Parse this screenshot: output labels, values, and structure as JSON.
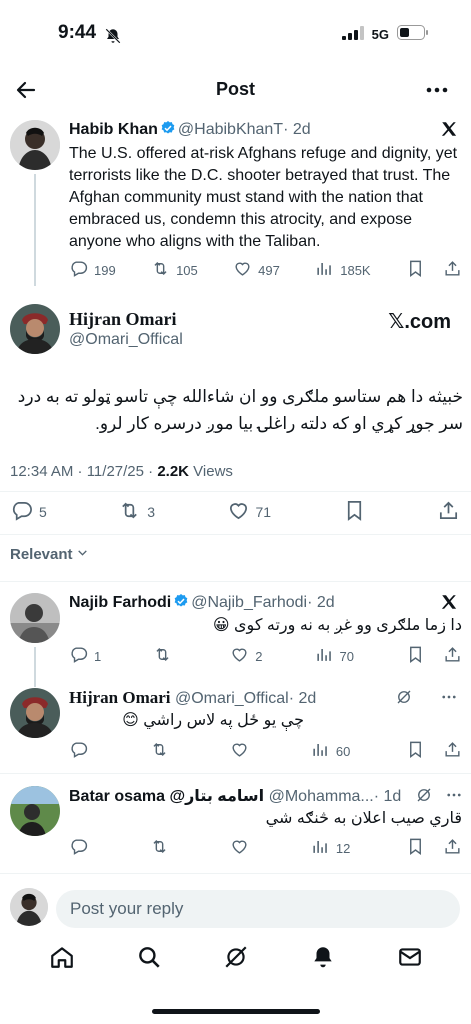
{
  "status": {
    "time": "9:44",
    "network": "5G"
  },
  "header": {
    "title": "Post"
  },
  "parent_tweet": {
    "name": "Habib Khan",
    "handle": "@HabibKhanT",
    "age": "· 2d",
    "text": "The U.S. offered at-risk Afghans refuge and dignity, yet terrorists like the D.C. shooter betrayed that trust. The Afghan community must stand with the nation that embraced us, condemn this atrocity, and expose anyone who aligns with the Taliban.",
    "replies": "199",
    "retweets": "105",
    "likes": "497",
    "views": "185K"
  },
  "main_tweet": {
    "name": "Hijran Omari",
    "handle": "@Omari_Offical",
    "watermark": "𝕏.com",
    "text": "خبيثه دا هم ستاسو ملګری وو ان شاءالله چې تاسو ټولو ته به درد سر جوړ کړي او که دلته راغلۍ بیا موږ درسره کار لرو.",
    "timestamp": "12:34 AM · 11/27/25 · ",
    "views_count": "2.2K",
    "views_label": " Views",
    "replies": "5",
    "retweets": "3",
    "likes": "71"
  },
  "sort": {
    "label": "Relevant"
  },
  "replies": [
    {
      "name": "Najib Farhodi",
      "handle": "@Najib_Farhodi",
      "age": "· 2d",
      "text": "دا زما ملګری وو غږ به نه ورته کوی 😀",
      "replies": "1",
      "retweets": "",
      "likes": "2",
      "views": "70"
    },
    {
      "name": "Hijran Omari",
      "handle": "@Omari_Offical",
      "age": "· 2d",
      "text": "چې یو ځل په لاس راشي 😊",
      "replies": "",
      "retweets": "",
      "likes": "",
      "views": "60"
    },
    {
      "name": "Batar osama @اسامه بتار",
      "handle": "@Mohamma...",
      "age": "· 1d",
      "text": "قاري صيب اعلان به څنګه شي",
      "replies": "",
      "retweets": "",
      "likes": "",
      "views": "12"
    }
  ],
  "composer": {
    "placeholder": "Post your reply"
  },
  "icons": [
    "back-arrow-icon",
    "more-icon",
    "x-logo-icon",
    "reply-icon",
    "retweet-icon",
    "like-icon",
    "views-icon",
    "bookmark-icon",
    "share-icon",
    "grok-icon",
    "home-icon",
    "search-icon",
    "bell-icon",
    "mail-icon"
  ],
  "colors": {
    "verified": "#1d9bf0",
    "text": "#0f1419",
    "muted": "#536471",
    "divider": "#eff3f4"
  }
}
